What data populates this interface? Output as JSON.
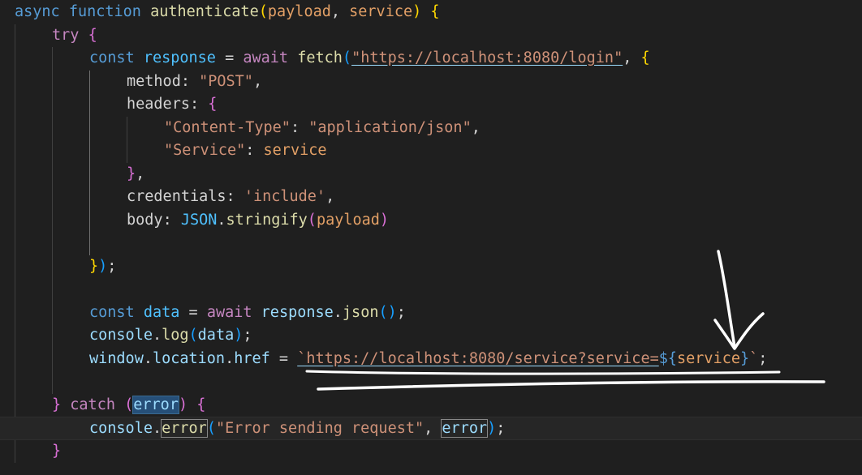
{
  "editor": {
    "lines": [
      [
        [
          "kw",
          "async"
        ],
        [
          "punc",
          " "
        ],
        [
          "kw",
          "function"
        ],
        [
          "punc",
          " "
        ],
        [
          "fn",
          "authenticate"
        ],
        [
          "b1",
          "("
        ],
        [
          "param",
          "payload"
        ],
        [
          "punc",
          ", "
        ],
        [
          "param",
          "service"
        ],
        [
          "b1",
          ")"
        ],
        [
          "punc",
          " "
        ],
        [
          "b1",
          "{"
        ]
      ],
      [
        [
          "ctl",
          "try"
        ],
        [
          "punc",
          " "
        ],
        [
          "b2",
          "{"
        ]
      ],
      [
        [
          "kw",
          "const"
        ],
        [
          "punc",
          " "
        ],
        [
          "const",
          "response"
        ],
        [
          "punc",
          " = "
        ],
        [
          "ctl",
          "await"
        ],
        [
          "punc",
          " "
        ],
        [
          "fn",
          "fetch"
        ],
        [
          "b3",
          "("
        ],
        [
          "str",
          "\"https://localhost:8080/login\""
        ],
        [
          "punc",
          ", "
        ],
        [
          "b1",
          "{"
        ]
      ],
      [
        [
          "prop",
          "method"
        ],
        [
          "punc",
          ": "
        ],
        [
          "str",
          "\"POST\""
        ],
        [
          "punc",
          ","
        ]
      ],
      [
        [
          "prop",
          "headers"
        ],
        [
          "punc",
          ": "
        ],
        [
          "b2",
          "{"
        ]
      ],
      [
        [
          "str",
          "\"Content-Type\""
        ],
        [
          "punc",
          ": "
        ],
        [
          "str",
          "\"application/json\""
        ],
        [
          "punc",
          ","
        ]
      ],
      [
        [
          "str",
          "\"Service\""
        ],
        [
          "punc",
          ": "
        ],
        [
          "param",
          "service"
        ]
      ],
      [
        [
          "b2",
          "}"
        ],
        [
          "punc",
          ","
        ]
      ],
      [
        [
          "prop",
          "credentials"
        ],
        [
          "punc",
          ": "
        ],
        [
          "str",
          "'include'"
        ],
        [
          "punc",
          ","
        ]
      ],
      [
        [
          "prop",
          "body"
        ],
        [
          "punc",
          ": "
        ],
        [
          "const",
          "JSON"
        ],
        [
          "punc",
          "."
        ],
        [
          "fn",
          "stringify"
        ],
        [
          "b2",
          "("
        ],
        [
          "param",
          "payload"
        ],
        [
          "b2",
          ")"
        ]
      ],
      [],
      [
        [
          "b1",
          "}"
        ],
        [
          "b3",
          ")"
        ],
        [
          "punc",
          ";"
        ]
      ],
      [],
      [
        [
          "kw",
          "const"
        ],
        [
          "punc",
          " "
        ],
        [
          "const",
          "data"
        ],
        [
          "punc",
          " = "
        ],
        [
          "ctl",
          "await"
        ],
        [
          "punc",
          " "
        ],
        [
          "var",
          "response"
        ],
        [
          "punc",
          "."
        ],
        [
          "fn",
          "json"
        ],
        [
          "b3",
          "()"
        ],
        [
          "punc",
          ";"
        ]
      ],
      [
        [
          "var",
          "console"
        ],
        [
          "punc",
          "."
        ],
        [
          "fn",
          "log"
        ],
        [
          "b3",
          "("
        ],
        [
          "var",
          "data"
        ],
        [
          "b3",
          ")"
        ],
        [
          "punc",
          ";"
        ]
      ],
      [
        [
          "var",
          "window"
        ],
        [
          "punc",
          "."
        ],
        [
          "var",
          "location"
        ],
        [
          "punc",
          "."
        ],
        [
          "var",
          "href"
        ],
        [
          "punc",
          " = "
        ],
        [
          "str",
          "`https://localhost:8080/service?service="
        ],
        [
          "kw",
          "${"
        ],
        [
          "param",
          "service"
        ],
        [
          "kw",
          "}"
        ],
        [
          "str",
          "`"
        ],
        [
          "punc",
          ";"
        ]
      ],
      [],
      [
        [
          "b2",
          "}"
        ],
        [
          "punc",
          " "
        ],
        [
          "ctl",
          "catch"
        ],
        [
          "punc",
          " "
        ],
        [
          "b2",
          "("
        ],
        [
          "var",
          "error"
        ],
        [
          "b2",
          ")"
        ],
        [
          "punc",
          " "
        ],
        [
          "b2",
          "{"
        ]
      ],
      [
        [
          "var",
          "console"
        ],
        [
          "punc",
          "."
        ],
        [
          "fn",
          "error"
        ],
        [
          "b3",
          "("
        ],
        [
          "str",
          "\"Error sending request\""
        ],
        [
          "punc",
          ", "
        ],
        [
          "var",
          "error"
        ],
        [
          "b3",
          ")"
        ],
        [
          "punc",
          ";"
        ]
      ],
      [
        [
          "b2",
          "}"
        ]
      ]
    ]
  }
}
